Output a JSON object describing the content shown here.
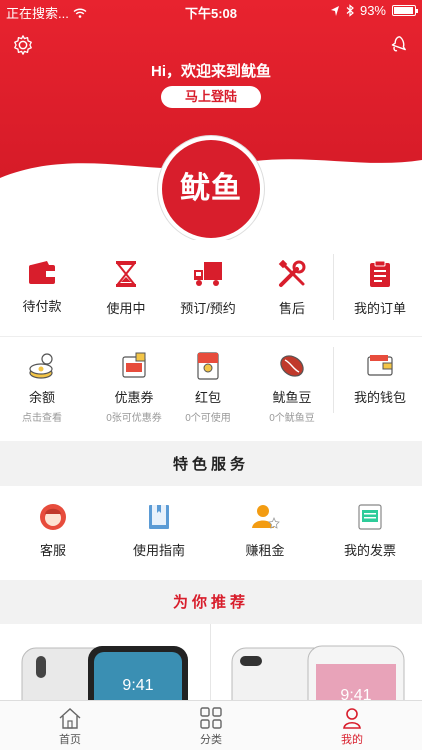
{
  "status_bar": {
    "carrier": "正在搜索...",
    "time": "下午5:08",
    "battery": "93%",
    "battery_level": 0.93
  },
  "header": {
    "welcome": "Hi，欢迎来到鱿鱼",
    "login_label": "马上登陆",
    "logo_text": "鱿鱼",
    "settings_icon": "gear-icon",
    "bell_icon": "bell-icon"
  },
  "orders": {
    "items": [
      {
        "label": "待付款",
        "icon": "wallet-icon"
      },
      {
        "label": "使用中",
        "icon": "hourglass-icon"
      },
      {
        "label": "预订/预约",
        "icon": "truck-icon"
      },
      {
        "label": "售后",
        "icon": "tools-icon"
      },
      {
        "label": "我的订单",
        "icon": "clipboard-icon"
      }
    ]
  },
  "wallet": {
    "items": [
      {
        "label": "余额",
        "sub": "点击查看",
        "icon": "coins-icon"
      },
      {
        "label": "优惠券",
        "sub": "0张可优惠券",
        "icon": "coupon-icon"
      },
      {
        "label": "红包",
        "sub": "0个可使用",
        "icon": "red-packet-icon"
      },
      {
        "label": "鱿鱼豆",
        "sub": "0个鱿鱼豆",
        "icon": "bean-icon"
      },
      {
        "label": "我的钱包",
        "sub": "",
        "icon": "purse-icon"
      }
    ]
  },
  "special_services": {
    "title": "特色服务",
    "items": [
      {
        "label": "客服",
        "icon": "support-agent-icon"
      },
      {
        "label": "使用指南",
        "icon": "guide-book-icon"
      },
      {
        "label": "赚租金",
        "icon": "earn-user-icon"
      },
      {
        "label": "我的发票",
        "icon": "invoice-printer-icon"
      }
    ]
  },
  "recommend": {
    "title": "为你推荐",
    "phone_time_1": "9:41",
    "phone_time_2": "9:41"
  },
  "tabbar": {
    "items": [
      {
        "label": "首页",
        "icon": "home-icon"
      },
      {
        "label": "分类",
        "icon": "grid-icon"
      },
      {
        "label": "我的",
        "icon": "person-icon"
      }
    ]
  },
  "colors": {
    "brand_red": "#d81e2c",
    "background": "#f2f2f2"
  }
}
